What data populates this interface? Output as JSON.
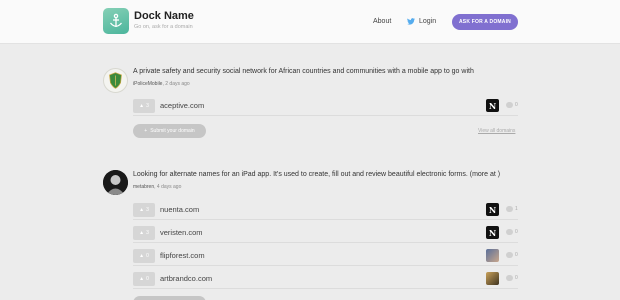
{
  "header": {
    "title": "Dock Name",
    "subtitle": "Go on, ask for a domain",
    "nav_about": "About",
    "nav_login": "Login",
    "ask_button": "ASK FOR A DOMAIN"
  },
  "posts": [
    {
      "title": "A private safety and security social network for African countries and communities with a mobile app to go with",
      "author": "iPoliceMobile",
      "time": ", 2 days ago",
      "submit_label": "Submit your domain",
      "view_all": "View all domains",
      "domains": [
        {
          "votes": "3",
          "name": "aceptive.com",
          "user_icon": "n-icon",
          "comments": "0"
        }
      ]
    },
    {
      "title": "Looking for alternate names for an iPad app. It's used to create, fill out and review beautiful electronic forms. (more at )",
      "author": "metabren",
      "time": ", 4 days ago",
      "domains": [
        {
          "votes": "3",
          "name": "nuenta.com",
          "user_icon": "n-icon",
          "comments": "1"
        },
        {
          "votes": "3",
          "name": "veristen.com",
          "user_icon": "n-icon",
          "comments": "0"
        },
        {
          "votes": "0",
          "name": "flipforest.com",
          "user_icon": "photo-avatar",
          "comments": "0"
        },
        {
          "votes": "0",
          "name": "artbrandco.com",
          "user_icon": "photo-avatar",
          "comments": "0"
        }
      ]
    }
  ],
  "colors": {
    "accent": "#8070d0",
    "logo": "#4bb59c",
    "background": "#ececec"
  }
}
